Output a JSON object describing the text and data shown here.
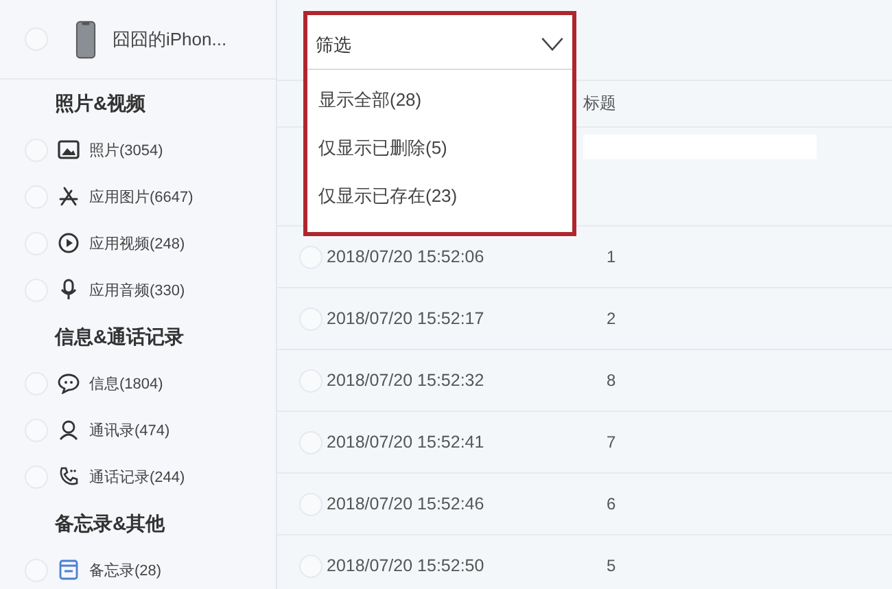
{
  "device": {
    "name": "囧囧的iPhon...",
    "checked": false
  },
  "sidebar": {
    "sections": [
      {
        "title": "照片&视频",
        "items": [
          {
            "label": "照片(3054)",
            "checked": false
          },
          {
            "label": "应用图片(6647)",
            "checked": false
          },
          {
            "label": "应用视频(248)",
            "checked": false
          },
          {
            "label": "应用音频(330)",
            "checked": false
          }
        ]
      },
      {
        "title": "信息&通话记录",
        "items": [
          {
            "label": "信息(1804)",
            "checked": false
          },
          {
            "label": "通讯录(474)",
            "checked": false
          },
          {
            "label": "通话记录(244)",
            "checked": false
          }
        ]
      },
      {
        "title": "备忘录&其他",
        "items": [
          {
            "label": "备忘录(28)",
            "checked": false
          }
        ]
      }
    ]
  },
  "filter": {
    "label": "筛选",
    "expanded": true,
    "highlighted": true,
    "options": [
      {
        "label": "显示全部(28)",
        "selected": false
      },
      {
        "label": "仅显示已删除(5)",
        "selected": false
      },
      {
        "label": "仅显示已存在(23)",
        "selected": false
      }
    ]
  },
  "table": {
    "title_heading": "标题",
    "rows": [
      {
        "date": "2018/07/20 15:52:06",
        "title": "1",
        "checked": false
      },
      {
        "date": "2018/07/20 15:52:17",
        "title": "2",
        "checked": false
      },
      {
        "date": "2018/07/20 15:52:32",
        "title": "8",
        "checked": false
      },
      {
        "date": "2018/07/20 15:52:41",
        "title": "7",
        "checked": false
      },
      {
        "date": "2018/07/20 15:52:46",
        "title": "6",
        "checked": false
      },
      {
        "date": "2018/07/20 15:52:50",
        "title": "5",
        "checked": false
      }
    ]
  }
}
